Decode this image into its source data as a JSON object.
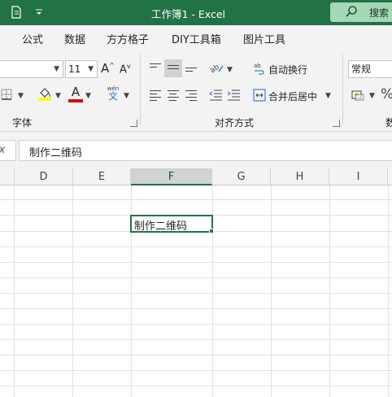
{
  "window": {
    "title": "工作簿1  -  Excel",
    "search_label": "搜索"
  },
  "tabs": [
    "公式",
    "数据",
    "方方格子",
    "DIY工具箱",
    "图片工具"
  ],
  "ribbon": {
    "font_size": "11",
    "grow_font": "A",
    "shrink_font": "A",
    "font_color_letter": "A",
    "phonetic_label": "wén",
    "phonetic_char": "文",
    "wrap_text": "自动换行",
    "merge_center": "合并后居中",
    "number_format": "常规",
    "percent": "%",
    "groups": {
      "font": "字体",
      "alignment": "对齐方式",
      "number": "数"
    }
  },
  "formula_bar": {
    "fx": "fx",
    "value": "制作二维码"
  },
  "sheet": {
    "columns": [
      "D",
      "E",
      "F",
      "G",
      "H",
      "I"
    ],
    "selected_column": "F",
    "active_cell_value": "制作二维码"
  },
  "colors": {
    "accent": "#217346",
    "search_bg": "#a6d7b6",
    "fill_yellow": "#ffff00",
    "font_red": "#e00000"
  }
}
